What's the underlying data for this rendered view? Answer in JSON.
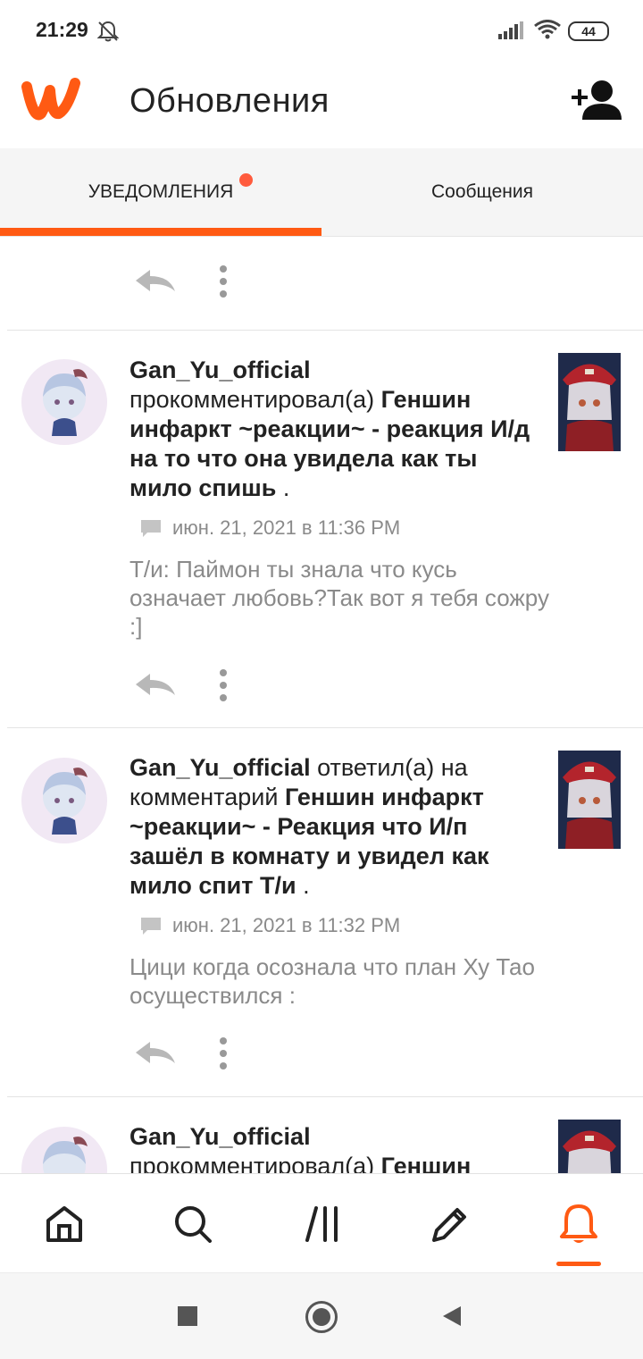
{
  "status_bar": {
    "time": "21:29",
    "battery": "44"
  },
  "app_bar": {
    "title": "Обновления"
  },
  "tabs": [
    {
      "label": "УВЕДОМЛЕНИЯ",
      "active": true,
      "has_dot": true
    },
    {
      "label": "Сообщения",
      "active": false
    }
  ],
  "notifications": [
    {
      "user": "Gan_Yu_official",
      "action": " прокомментировал(а) ",
      "story": "Геншин инфаркт ~реакции~ - реакция И/д на то что она увидела как ты мило спишь",
      "suffix": " .",
      "date": "июн. 21, 2021 в 11:36 PM",
      "quote": "Т/и: Паймон ты знала что кусь означает любовь?Так вот я тебя сожру :]"
    },
    {
      "user": "Gan_Yu_official",
      "action": " ответил(а) на комментарий ",
      "story": "Геншин инфаркт ~реакции~ - Реакция что И/п зашёл в комнату и увидел как мило спит Т/и",
      "suffix": " .",
      "date": "июн. 21, 2021 в 11:32 PM",
      "quote": "Цици когда осознала что план Ху Тао осуществился :"
    },
    {
      "user": "Gan_Yu_official",
      "action": " прокомментировал(а) ",
      "story": "Геншин",
      "suffix": ""
    }
  ],
  "bottom_nav": [
    {
      "icon": "home-icon"
    },
    {
      "icon": "search-icon"
    },
    {
      "icon": "library-icon"
    },
    {
      "icon": "write-icon"
    },
    {
      "icon": "notifications-icon",
      "active": true
    }
  ],
  "colors": {
    "accent": "#ff5a13",
    "tab_dot": "#ff5b3d",
    "muted": "#8a8a8a"
  }
}
